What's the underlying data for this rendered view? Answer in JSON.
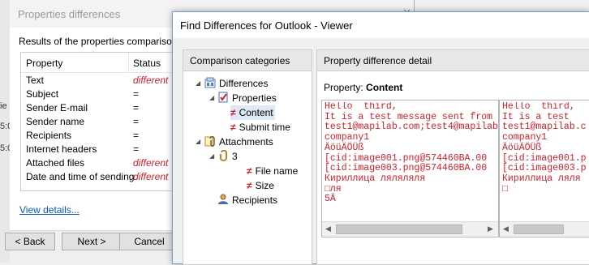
{
  "background_window": {
    "title": "Properties differences",
    "close": "✕",
    "results_title": "Results of the properties comparison",
    "columns": [
      "Property",
      "Status"
    ],
    "rows": [
      {
        "property": "Text",
        "status": "different",
        "diff": true
      },
      {
        "property": "Subject",
        "status": "=",
        "diff": false
      },
      {
        "property": "Sender E-mail",
        "status": "=",
        "diff": false
      },
      {
        "property": "Sender name",
        "status": "=",
        "diff": false
      },
      {
        "property": "Recipients",
        "status": "=",
        "diff": false
      },
      {
        "property": "Internet headers",
        "status": "=",
        "diff": false
      },
      {
        "property": "Attached files",
        "status": "different",
        "diff": true
      },
      {
        "property": "Date and time of sending",
        "status": "different",
        "diff": true
      }
    ],
    "view_details": "View details...",
    "buttons": {
      "back": "< Back",
      "next": "Next >",
      "cancel": "Cancel"
    },
    "left_strip_labels": [
      "ie",
      "5:0",
      "5:0"
    ]
  },
  "viewer": {
    "title": "Find Differences for Outlook - Viewer",
    "categories_header": "Comparison categories",
    "detail_header": "Property difference detail",
    "property_label": "Property:",
    "property_value": "Content",
    "tree": {
      "differences": "Differences",
      "properties": "Properties",
      "content": "Content",
      "submit_time": "Submit time",
      "attachments": "Attachments",
      "attachment_index": "3",
      "file_name": "File name",
      "size": "Size",
      "recipients": "Recipients"
    },
    "left_text": "Hello  third,\nIt is a test message sent from\ntest1@mapilab.com;test4@mapilab\ncompany1\nÄöüÄÖÜß\n[cid:image001.png@574460BA.00\n[cid:image003.png@574460BA.00\nКириллица ляляляля\n□ля\n5Ä",
    "right_text": "Hello  third,\nIt is a test\ntest1@mapilab.c\ncompany1\nÄöüÄÖÜß\n[cid:image001.p\n[cid:image003.p\nКириллица ляля\n□",
    "colors": {
      "diff_red": "#d0202a",
      "link_blue": "#0a57c2",
      "selection": "#dde8f8"
    }
  }
}
